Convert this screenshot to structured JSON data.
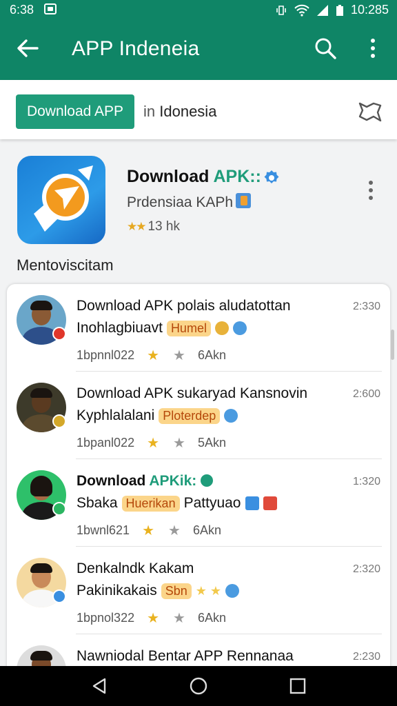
{
  "status_bar": {
    "time": "6:38",
    "right_time": "10:285",
    "icons": [
      "notification-box-icon",
      "vibrate-icon",
      "wifi-icon",
      "signal-icon",
      "battery-icon"
    ]
  },
  "app_bar": {
    "title": "APP Indeneia",
    "icons": [
      "back-arrow-icon",
      "search-icon",
      "more-vert-icon"
    ]
  },
  "search_bar": {
    "button_label": "Download APP",
    "in_prefix": "in",
    "region": "Idonesia",
    "icon": "bookmark-icon"
  },
  "app_card": {
    "name_main": "Download",
    "name_accent": "APK::",
    "developer": "Prdensiaa KAPh",
    "stars": "★★",
    "rating": "13 hk",
    "section_title": "Mentoviscitam",
    "accent_color": "#1f9c7a"
  },
  "list": {
    "rows": [
      {
        "line1_main": "Download APK polais aludatottan",
        "line1_accent": "",
        "line2_text": "Inohlagbiuavt",
        "tag": "Humel",
        "time": "2:330",
        "downloads": "1bpnnl022",
        "star_y": "★",
        "star_g": "★",
        "size": "6Akn"
      },
      {
        "line1_main": "Download APK sukaryad Kansnovin",
        "line1_accent": "",
        "line2_text": "Kyphlalalani",
        "tag": "Ploterdep",
        "time": "2:600",
        "downloads": "1bpanl022",
        "star_y": "★",
        "star_g": "★",
        "size": "5Akn"
      },
      {
        "line1_main": "Download",
        "line1_accent": "APKik:",
        "line2_text": "Sbaka",
        "tag": "Huerikan",
        "line2_suffix": "Pattyuao",
        "time": "1:320",
        "downloads": "1bwnl621",
        "star_y": "★",
        "star_g": "★",
        "size": "6Akn"
      },
      {
        "line1_main": "Denkalndk Kakam",
        "line1_accent": "",
        "line2_text": "Pakinikakais",
        "tag": "Sbn",
        "time": "2:320",
        "downloads": "1bpnol322",
        "star_y": "★",
        "star_g": "★",
        "size": "6Akn"
      },
      {
        "line1_main": "Nawniodal Bentar APP Rennanaa",
        "line1_accent": "",
        "time": "2:230"
      }
    ]
  },
  "nav_bar": {
    "icons": [
      "back-triangle-icon",
      "home-circle-icon",
      "recents-square-icon"
    ]
  }
}
